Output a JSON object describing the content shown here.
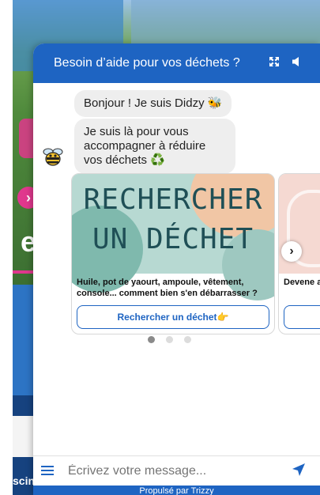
{
  "background_site": {
    "arrow": "›",
    "letter": "e",
    "footer_text": "scin"
  },
  "chat": {
    "title": "Besoin d’aide pour vos déchets ?",
    "header_icons": [
      "expand-icon",
      "speaker-icon"
    ],
    "messages": [
      "Bonjour ! Je suis Didzy 🐝",
      "Je suis là pour vous accompagner à réduire vos déchets ♻️"
    ],
    "cards": [
      {
        "image_text": [
          "RECHERCHER",
          "UN DÉCHET"
        ],
        "description": "Huile, pot de yaourt, ampoule, vêtement, console... comment bien s'en débarrasser ?",
        "button": "Rechercher un déchet👉"
      },
      {
        "description": "Devene avec le",
        "button": ""
      }
    ],
    "carousel_next": "›",
    "input_placeholder": "Écrivez votre message...",
    "powered_by": "Propulsé par Trizzy"
  },
  "colors": {
    "accent": "#1e64c2",
    "site_pink": "#e0378d",
    "site_navy": "#16427f"
  }
}
